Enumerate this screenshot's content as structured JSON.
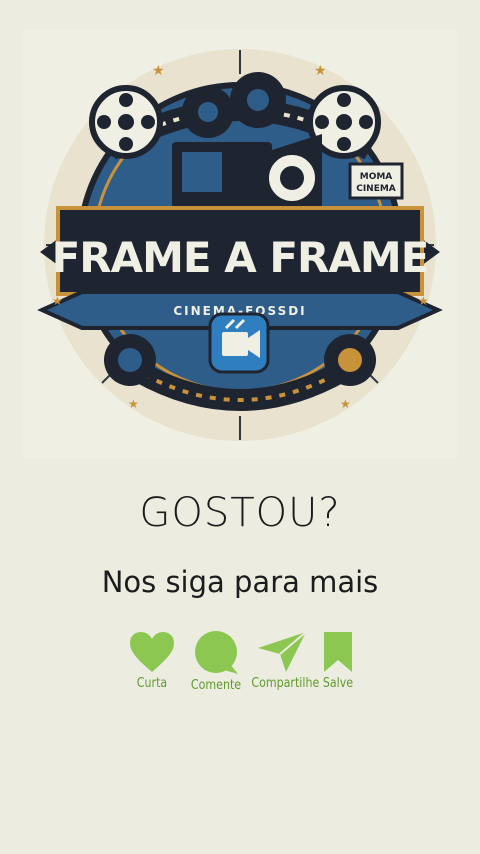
{
  "logo": {
    "title": "FRAME A FRAME",
    "subtitle": "CINEMA-FOSSDI",
    "badge": "MOMA CINEMA",
    "badge_line1": "MOMA",
    "badge_line2": "CINEMA"
  },
  "headline": "GOSTOU?",
  "subline": "Nos siga para mais",
  "actions": [
    {
      "label": "Curta",
      "icon": "heart-icon"
    },
    {
      "label": "Comente",
      "icon": "speech-bubble-icon"
    },
    {
      "label": "Compartilhe",
      "icon": "paper-plane-icon"
    },
    {
      "label": "Salve",
      "icon": "bookmark-icon"
    }
  ],
  "colors": {
    "background": "#ecece1",
    "accent_green": "#8cc751",
    "label_green": "#5f9b2c",
    "logo_blue": "#2f5d8a",
    "logo_dark": "#1e2430",
    "logo_gold": "#c8923a"
  }
}
